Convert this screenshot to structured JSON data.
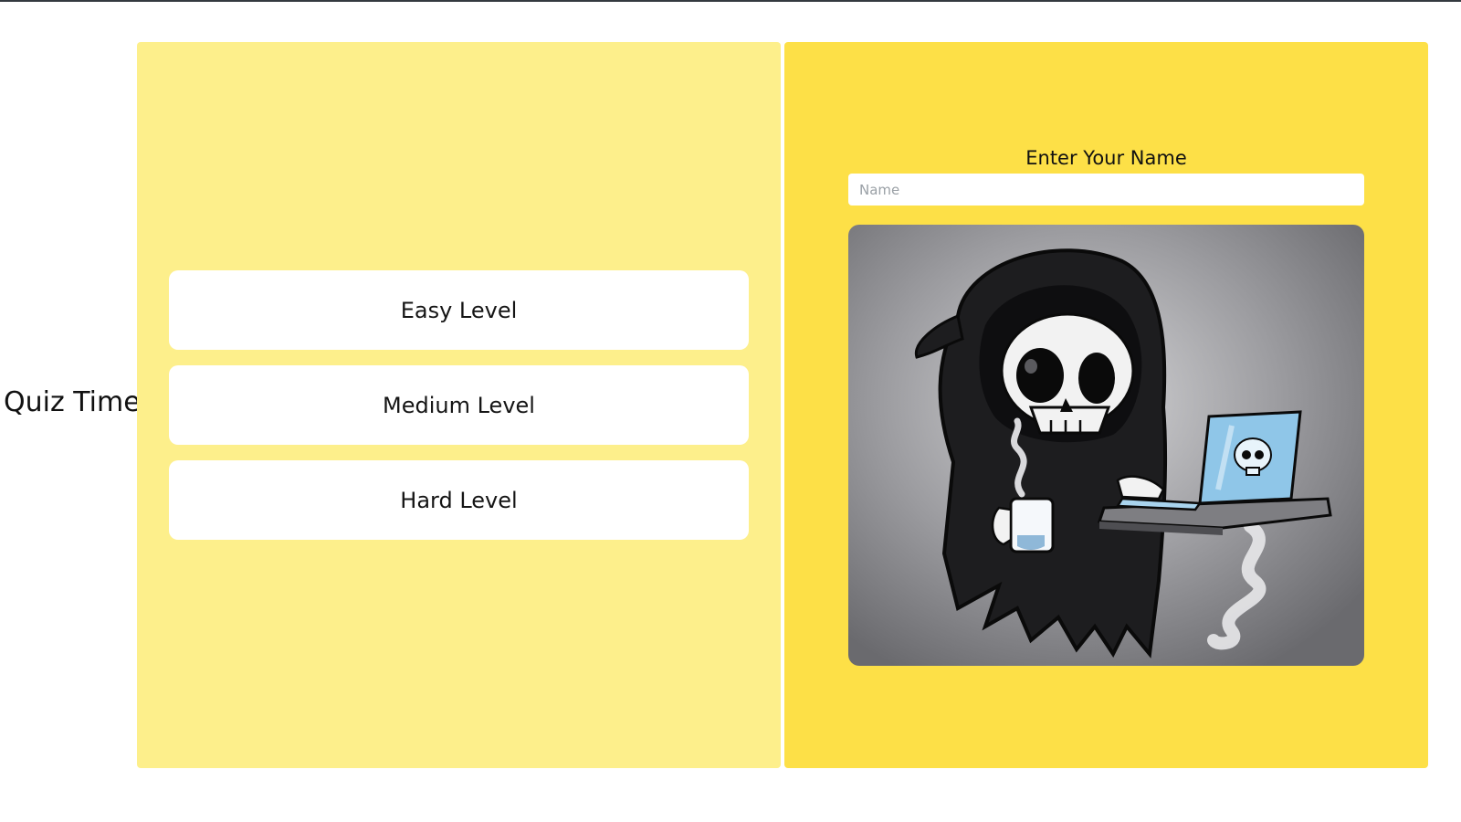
{
  "sidebar": {
    "title": "Quiz Time"
  },
  "levels": {
    "easy_label": "Easy Level",
    "medium_label": "Medium Level",
    "hard_label": "Hard Level"
  },
  "player": {
    "label": "Enter Your Name",
    "name_placeholder": "Name",
    "name_value": ""
  },
  "illustration": {
    "icon": "grim-reaper-with-laptop-and-coffee-illustration"
  },
  "colors": {
    "left_panel_bg": "#fdef8b",
    "right_panel_bg": "#fde047",
    "button_bg": "#ffffff"
  }
}
